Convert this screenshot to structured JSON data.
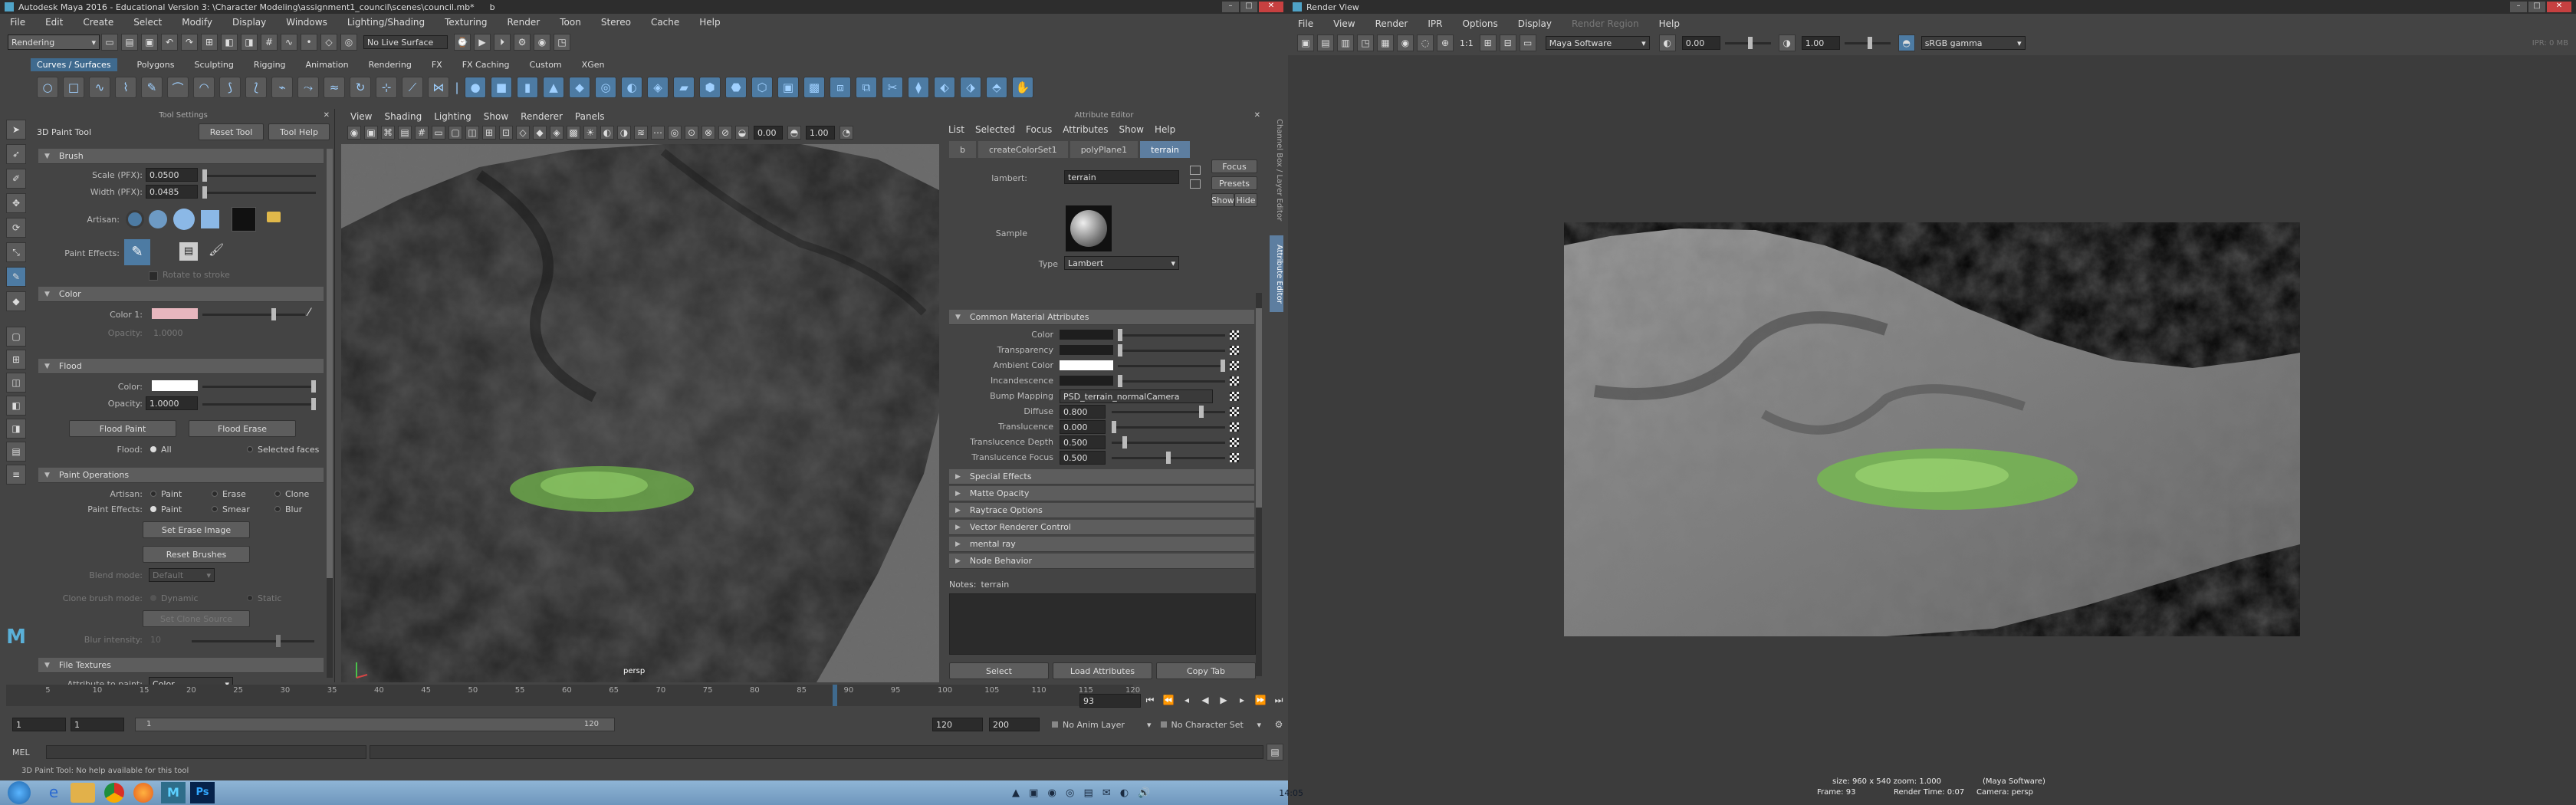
{
  "maya": {
    "title": "Autodesk Maya 2016 - Educational Version 3: \\Character Modeling\\assignment1_council\\scenes\\council.mb*",
    "title_extra": "b",
    "menus": [
      "File",
      "Edit",
      "Create",
      "Select",
      "Modify",
      "Display",
      "Windows",
      "Lighting/Shading",
      "Texturing",
      "Render",
      "Toon",
      "Stereo",
      "Cache",
      "Help"
    ],
    "mode": "Rendering",
    "live_surface": "No Live Surface",
    "shelf_tabs": [
      "Curves / Surfaces",
      "Polygons",
      "Sculpting",
      "Rigging",
      "Animation",
      "Rendering",
      "FX",
      "FX Caching",
      "Custom",
      "XGen"
    ],
    "shelf_active": "Curves / Surfaces"
  },
  "tool_settings": {
    "panel_title": "Tool Settings",
    "tool_name": "3D Paint Tool",
    "reset_tool": "Reset Tool",
    "tool_help": "Tool Help",
    "brush": {
      "header": "Brush",
      "scale_label": "Scale (PFX):",
      "scale_value": "0.0500",
      "width_label": "Width (PFX):",
      "width_value": "0.0485",
      "artisan_label": "Artisan:",
      "paint_effects_label": "Paint Effects:",
      "rotate_label": "Rotate to stroke"
    },
    "color": {
      "header": "Color",
      "color1_label": "Color 1:",
      "color1": "#e8b6be",
      "opacity_label": "Opacity:",
      "opacity_value": "1.0000"
    },
    "flood": {
      "header": "Flood",
      "color_label": "Color:",
      "color": "#ffffff",
      "opacity_label": "Opacity:",
      "opacity_value": "1.0000",
      "flood_paint": "Flood Paint",
      "flood_erase": "Flood Erase",
      "flood_label": "Flood:",
      "flood_all": "All",
      "flood_selected": "Selected faces"
    },
    "paint_ops": {
      "header": "Paint Operations",
      "artisan_label": "Artisan:",
      "artisan_opts": [
        "Paint",
        "Erase",
        "Clone"
      ],
      "pe_label": "Paint Effects:",
      "pe_opts": [
        "Paint",
        "Smear",
        "Blur"
      ],
      "set_erase": "Set Erase Image",
      "reset_brushes": "Reset Brushes",
      "blend_label": "Blend mode:",
      "blend_value": "Default",
      "clone_label": "Clone brush mode:",
      "clone_opts": [
        "Dynamic",
        "Static"
      ],
      "set_clone": "Set Clone Source",
      "blur_label": "Blur intensity:",
      "blur_value": "10"
    },
    "file_textures": {
      "header": "File Textures",
      "attr_label": "Attribute to paint:",
      "attr_value": "Color"
    }
  },
  "viewport": {
    "menus": [
      "View",
      "Shading",
      "Lighting",
      "Show",
      "Renderer",
      "Panels"
    ],
    "field1": "0.00",
    "field2": "1.00",
    "camera_label": "persp"
  },
  "attr_editor": {
    "panel_title": "Attribute Editor",
    "menus": [
      "List",
      "Selected",
      "Focus",
      "Attributes",
      "Show",
      "Help"
    ],
    "tabs": [
      "b",
      "createColorSet1",
      "polyPlane1",
      "terrain"
    ],
    "active_tab": "terrain",
    "lambert_label": "lambert:",
    "lambert_value": "terrain",
    "focus": "Focus",
    "presets": "Presets",
    "show": "Show",
    "hide": "Hide",
    "sample_label": "Sample",
    "type_label": "Type",
    "type_value": "Lambert",
    "common_header": "Common Material Attributes",
    "attrs": [
      {
        "label": "Color",
        "kind": "swatch",
        "color": "#1e1e1e"
      },
      {
        "label": "Transparency",
        "kind": "swatch",
        "color": "#1e1e1e"
      },
      {
        "label": "Ambient Color",
        "kind": "swatch",
        "color": "#ffffff"
      },
      {
        "label": "Incandescence",
        "kind": "swatch",
        "color": "#1e1e1e"
      },
      {
        "label": "Bump Mapping",
        "kind": "text",
        "value": "PSD_terrain_normalCamera"
      },
      {
        "label": "Diffuse",
        "kind": "num",
        "value": "0.800",
        "pos": 0.8
      },
      {
        "label": "Translucence",
        "kind": "num",
        "value": "0.000",
        "pos": 0.0
      },
      {
        "label": "Translucence Depth",
        "kind": "num",
        "value": "0.500",
        "pos": 0.1
      },
      {
        "label": "Translucence Focus",
        "kind": "num",
        "value": "0.500",
        "pos": 0.5
      }
    ],
    "collapsed": [
      "Special Effects",
      "Matte Opacity",
      "Raytrace Options",
      "Vector Renderer Control",
      "mental ray",
      "Node Behavior"
    ],
    "notes_label": "Notes:",
    "notes_value": "terrain",
    "select": "Select",
    "load_attrs": "Load Attributes",
    "copy_tab": "Copy Tab",
    "side_tabs": [
      "Channel Box / Layer Editor",
      "Attribute Editor"
    ]
  },
  "timeline": {
    "ticks": [
      "5",
      "10",
      "15",
      "20",
      "25",
      "30",
      "35",
      "40",
      "45",
      "50",
      "55",
      "60",
      "65",
      "70",
      "75",
      "80",
      "85",
      "90",
      "95",
      "100",
      "105",
      "110",
      "115",
      "120"
    ],
    "current_frame": "93",
    "range_start": "1",
    "range_start2": "1",
    "range_inner_start": "1",
    "range_inner_end": "120",
    "range_end": "120",
    "range_end2": "200",
    "anim_layer": "No Anim Layer",
    "char_set": "No Character Set"
  },
  "command": {
    "mel_label": "MEL",
    "help_line": "3D Paint Tool: No help available for this tool"
  },
  "taskbar": {
    "time": "14:05"
  },
  "render_view": {
    "title": "Render View",
    "menus": [
      "File",
      "View",
      "Render",
      "IPR",
      "Options",
      "Display",
      "Render Region",
      "Help"
    ],
    "ratio": "1:1",
    "renderer": "Maya Software",
    "exposure": "0.00",
    "gamma": "1.00",
    "color_space": "sRGB gamma",
    "ipr_label": "IPR: 0 MB",
    "info_line1": "size: 960 x 540  zoom: 1.000",
    "info_line1_right": "(Maya Software)",
    "info_line2": "Frame: 93",
    "info_line2_mid": "Render Time: 0:07",
    "info_line2_right": "Camera: persp"
  }
}
